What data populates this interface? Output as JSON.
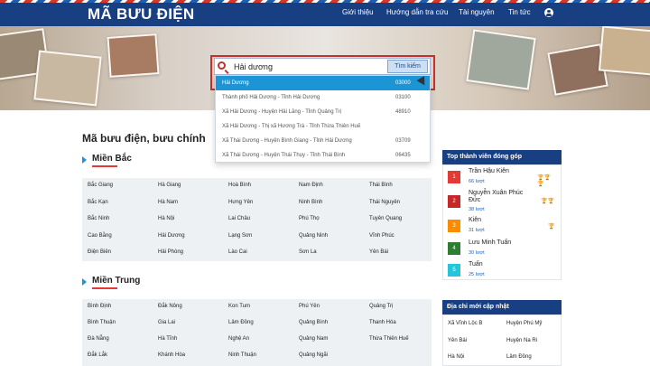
{
  "header": {
    "logo": "MÃ BƯU ĐIỆN",
    "nav": [
      "Giới thiệu",
      "Hướng dẫn tra cứu",
      "Tài nguyên",
      "Tin tức"
    ]
  },
  "search": {
    "value": "Hải dương",
    "button": "Tìm kiếm"
  },
  "suggestions": [
    {
      "name": "Hải Dương",
      "code": "03000"
    },
    {
      "name": "Thành phố Hải Dương - Tỉnh Hải Dương",
      "code": "03100"
    },
    {
      "name": "Xã Hải Dương - Huyện Hải Lăng - Tỉnh Quảng Trị",
      "code": "48910"
    },
    {
      "name": "Xã Hải Dương - Thị xã Hương Trà - Tỉnh Thừa Thiên Huế",
      "code": ""
    },
    {
      "name": "Xã Thái Dương - Huyện Bình Giang - Tỉnh Hải Dương",
      "code": "03709"
    },
    {
      "name": "Xã Thái Dương - Huyện Thái Thụy - Tỉnh Thái Bình",
      "code": "06435"
    }
  ],
  "main": {
    "title": "Mã bưu điện, bưu chính"
  },
  "regions": {
    "north": {
      "title": "Miền Bắc",
      "cells": [
        "Bắc Giang",
        "Hà Giang",
        "Hoà Bình",
        "Nam Định",
        "Thái Bình",
        "Bắc Kạn",
        "Hà Nam",
        "Hưng Yên",
        "Ninh Bình",
        "Thái Nguyên",
        "Bắc Ninh",
        "Hà Nội",
        "Lai Châu",
        "Phú Thọ",
        "Tuyên Quang",
        "Cao Bằng",
        "Hải Dương",
        "Lạng Sơn",
        "Quảng Ninh",
        "Vĩnh Phúc",
        "Điện Biên",
        "Hải Phòng",
        "Lào Cai",
        "Sơn La",
        "Yên Bái"
      ]
    },
    "central": {
      "title": "Miền Trung",
      "cells": [
        "Bình Định",
        "Đắk Nông",
        "Kon Tum",
        "Phú Yên",
        "Quảng Trị",
        "Bình Thuận",
        "Gia Lai",
        "Lâm Đồng",
        "Quảng Bình",
        "Thanh Hóa",
        "Đà Nẵng",
        "Hà Tĩnh",
        "Nghệ An",
        "Quảng Nam",
        "Thừa Thiên Huế",
        "Đắk Lắk",
        "Khánh Hòa",
        "Ninh Thuận",
        "Quảng Ngãi",
        ""
      ]
    }
  },
  "top_members": {
    "title": "Top thành viên đóng góp",
    "members": [
      {
        "rank": "1",
        "name": "Trần Hậu Kiên",
        "count": "66 lượt",
        "color": "#e53935",
        "trophies": "🏆🏆🏆"
      },
      {
        "rank": "2",
        "name": "Nguyễn Xuân Phúc Đức",
        "count": "38 lượt",
        "color": "#c62828",
        "trophies": "🏆🏆"
      },
      {
        "rank": "3",
        "name": "Kiên",
        "count": "31 lượt",
        "color": "#fb8c00",
        "trophies": "🏆"
      },
      {
        "rank": "4",
        "name": "Lưu Minh Tuấn",
        "count": "30 lượt",
        "color": "#2e7d32",
        "trophies": ""
      },
      {
        "rank": "5",
        "name": "Tuấn",
        "count": "25 lượt",
        "color": "#26c6da",
        "trophies": ""
      }
    ]
  },
  "new_addresses": {
    "title": "Địa chỉ mới cập nhật",
    "items": [
      "Xã Vĩnh Lộc B",
      "Huyện Phú Mỹ",
      "Yên Bái",
      "Huyện Na Ri",
      "Hà Nội",
      "Lâm Đồng"
    ]
  }
}
